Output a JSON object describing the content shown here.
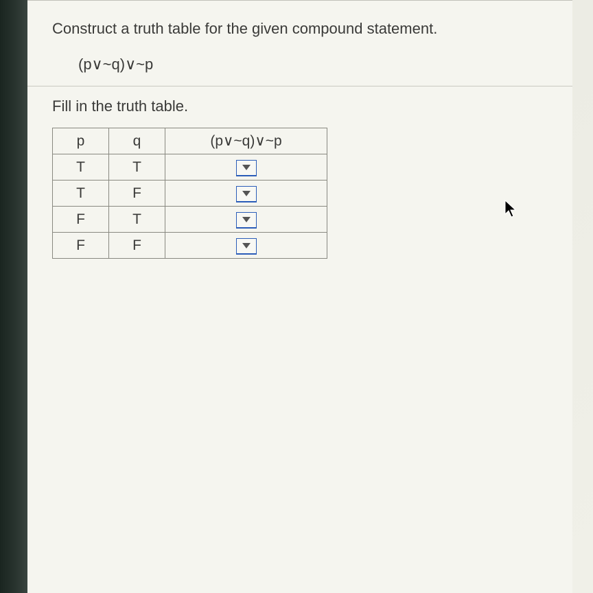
{
  "question": {
    "prompt": "Construct a truth table for the given compound statement.",
    "formula": "(p∨~q)∨~p"
  },
  "instruction": "Fill in the truth table.",
  "table": {
    "headers": {
      "p": "p",
      "q": "q",
      "result": "(p∨~q)∨~p"
    },
    "rows": [
      {
        "p": "T",
        "q": "T"
      },
      {
        "p": "T",
        "q": "F"
      },
      {
        "p": "F",
        "q": "T"
      },
      {
        "p": "F",
        "q": "F"
      }
    ]
  }
}
